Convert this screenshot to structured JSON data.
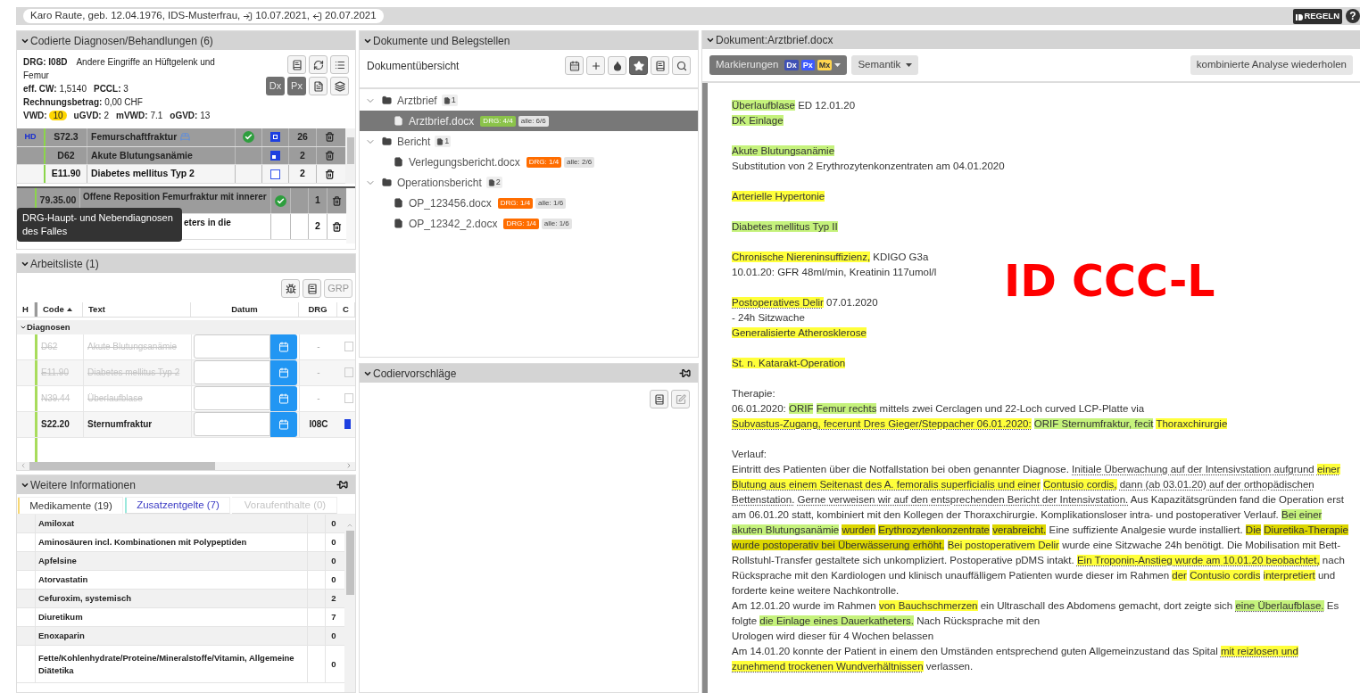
{
  "patient": {
    "info": "Karo Raute, geb. 12.04.1976, IDS-Musterfrau,",
    "admission": "10.07.2021,",
    "discharge": "20.07.2021"
  },
  "rules_button": "REGELN",
  "help_button": "?",
  "coded_panel": {
    "title": "Codierte Diagnosen/Behandlungen (6)",
    "drg": {
      "code": "DRG: I08D",
      "description": "Andere Eingriffe an Hüftgelenk und Femur"
    },
    "drg_rows": [
      [
        {
          "label": "eff. CW:",
          "value": "1,5140",
          "highlight": false
        },
        {
          "label": "PCCL:",
          "value": "3",
          "highlight": false
        }
      ],
      [
        {
          "label": "Rechnungsbetrag:",
          "value": "0,00 CHF",
          "highlight": false
        }
      ],
      [
        {
          "label": "VWD:",
          "value": "10",
          "highlight": true
        },
        {
          "label": "uGVD:",
          "value": "2",
          "highlight": false
        },
        {
          "label": "mVWD:",
          "value": "7.1",
          "highlight": false
        },
        {
          "label": "oGVD:",
          "value": "13",
          "highlight": false
        }
      ]
    ],
    "view_buttons": [
      {
        "label": "Dx",
        "selected": true
      },
      {
        "label": "Px",
        "selected": true
      }
    ],
    "diagnoses": [
      {
        "type": "HD",
        "code": "S72.3",
        "text": "Femurschaftfraktur",
        "bed_icon": true,
        "confirmed": true,
        "kind": "full",
        "count": "26",
        "selected": true
      },
      {
        "code": "D62",
        "text": "Akute Blutungsanämie",
        "bed_icon": false,
        "confirmed": false,
        "kind": "partial",
        "count": "2",
        "selected": true
      },
      {
        "code": "E11.90",
        "text": "Diabetes mellitus Typ 2",
        "bed_icon": false,
        "confirmed": false,
        "kind": "empty",
        "count": "2",
        "selected": false
      }
    ],
    "procedures": [
      {
        "code": "79.35.00",
        "text": "Offene Reposition Femurfraktur mit innerer",
        "confirmed": true,
        "count": "1",
        "selected": true
      },
      {
        "text": "eters in die",
        "confirmed": false,
        "count": "2",
        "selected": false
      }
    ],
    "tooltip": "DRG-Haupt- und Nebendiagnosen des Falles"
  },
  "worklist": {
    "title": "Arbeitsliste (1)",
    "grp_button": "GRP",
    "columns": [
      {
        "label": "H"
      },
      {
        "label": "Code",
        "sorted": true
      },
      {
        "label": "Text"
      },
      {
        "label": "Datum"
      },
      {
        "label": "DRG"
      },
      {
        "label": "C"
      }
    ],
    "group": {
      "label": "Diagnosen",
      "expanded": true
    },
    "rows": [
      {
        "code": "D62",
        "text": "Akute Blutungsanämie",
        "drg": "-",
        "deleted": true
      },
      {
        "code": "E11.90",
        "text": "Diabetes mellitus Typ 2",
        "drg": "-",
        "deleted": true
      },
      {
        "code": "N39.44",
        "text": "Überlaufblase",
        "drg": "-",
        "deleted": true
      },
      {
        "code": "S22.20",
        "text": "Sternumfraktur",
        "drg": "I08C",
        "deleted": false
      }
    ]
  },
  "info_panel": {
    "title": "Weitere Informationen",
    "pinned": true,
    "tabs": [
      {
        "label": "Medikamente (19)",
        "selected": true,
        "disabled": false,
        "color": "#f7d774"
      },
      {
        "label": "Zusatzentgelte (7)",
        "selected": false,
        "disabled": false,
        "color": "#9be8dc"
      },
      {
        "label": "Voraufenthalte (0)",
        "selected": false,
        "disabled": true
      }
    ],
    "rows": [
      {
        "name": "Amiloxat",
        "count": "0"
      },
      {
        "name": "Aminosäuren incl. Kombinationen mit Polypeptiden",
        "count": "0"
      },
      {
        "name": "Apfelsine",
        "count": "0"
      },
      {
        "name": "Atorvastatin",
        "count": "0"
      },
      {
        "name": "Cefuroxim, systemisch",
        "count": "2"
      },
      {
        "name": "Diuretikum",
        "count": "7"
      },
      {
        "name": "Enoxaparin",
        "count": "0"
      },
      {
        "name": "Fette/Kohlenhydrate/Proteine/Mineralstoffe/Vitamin, Allgemeine Diätetika",
        "count": "0"
      }
    ]
  },
  "documents_panel": {
    "title": "Dokumente und Belegstellen",
    "subtitle": "Dokumentübersicht",
    "toolbar": [
      {
        "selected": false
      },
      {
        "selected": false
      },
      {
        "selected": false
      },
      {
        "selected": true
      },
      {
        "selected": false
      },
      {
        "selected": false
      }
    ],
    "tree": [
      {
        "label": "Arztbrief",
        "count": "1",
        "expanded": true,
        "children": [
          {
            "label": "Arztbrief.docx",
            "selected": true,
            "drg": "DRG: 4/4",
            "color": "#8bc34a",
            "all": "alle: 6/6"
          }
        ]
      },
      {
        "label": "Bericht",
        "count": "1",
        "expanded": true,
        "children": [
          {
            "label": "Verlegungsbericht.docx",
            "selected": false,
            "drg": "DRG: 1/4",
            "color": "#ff6d00",
            "all": "alle: 2/6"
          }
        ]
      },
      {
        "label": "Operationsbericht",
        "count": "2",
        "expanded": true,
        "children": [
          {
            "label": "OP_123456.docx",
            "selected": false,
            "drg": "DRG: 1/4",
            "color": "#ff6d00",
            "all": "alle: 1/6"
          },
          {
            "label": "OP_12342_2.docx",
            "selected": false,
            "drg": "DRG: 1/4",
            "color": "#ff6d00",
            "all": "alle: 1/6"
          }
        ]
      }
    ]
  },
  "suggestions_panel": {
    "title": "Codiervorschläge",
    "pinned": true
  },
  "document_panel": {
    "title": "Dokument:Arztbrief.docx",
    "markings_button": {
      "label": "Markierungen",
      "badges": [
        {
          "text": "Dx",
          "color": "#3f51b5"
        },
        {
          "text": "Px",
          "color": "#3d5afe"
        },
        {
          "text": "Mx",
          "color": "#ffd54f"
        }
      ]
    },
    "semantics_button": "Semantik",
    "reanalyze_button": "kombinierte Analyse wiederholen",
    "overlay_label": "ID CCC-L",
    "sections": [
      [
        [
          {
            "text": "Überlaufblase",
            "color": "#c5f27c"
          },
          {
            "text": "ED 12.01.20"
          }
        ],
        [
          {
            "text": "DK Einlage",
            "color": "#c5f27c"
          }
        ]
      ],
      [
        [
          {
            "text": "Akute Blutungsanämie",
            "color": "#c5f27c"
          }
        ],
        [
          {
            "text": "Substitution von 2 Erythrozytenkonzentraten am 04.01.2020"
          }
        ]
      ],
      [
        [
          {
            "text": "Arterielle Hypertonie",
            "color": "#ffff3a"
          }
        ]
      ],
      [
        [
          {
            "text": "Diabetes mellitus Typ II",
            "color": "#c5f27c"
          }
        ]
      ],
      [
        [
          {
            "text": "Chronische Niereninsuffizienz,",
            "color": "#ffff3a"
          },
          {
            "text": "KDIGO G3a"
          }
        ],
        [
          {
            "text": "10.01.20: GFR 48ml/min, Kreatinin 117umol/l"
          }
        ]
      ],
      [
        [
          {
            "text": "Postoperatives Delir",
            "color": "#ffff3a",
            "dotted": true
          },
          {
            "text": "07.01.2020"
          }
        ],
        [
          {
            "text": "- 24h Sitzwache"
          }
        ],
        [
          {
            "text": "Generalisierte Atherosklerose",
            "color": "#ffff3a"
          }
        ]
      ],
      [
        [
          {
            "text": "St. n. Katarakt-Operation",
            "color": "#ffff3a"
          }
        ]
      ],
      [
        [
          {
            "text": "Therapie:"
          }
        ],
        [
          {
            "text": "06.01.2020:"
          },
          {
            "text": "ORIF",
            "color": "#c5f27c"
          },
          {
            "text": "Femur rechts",
            "color": "#c5f27c"
          },
          {
            "text": "mittels zwei Cerclagen und 22-Loch curved LCP-Platte via"
          }
        ],
        [
          {
            "text": "Subvastus-Zugang, fecerunt Dres Gieger/Steppacher 06.01.2020:",
            "color": "#ffff3a",
            "dotted": true
          },
          {
            "text": "ORIF Sternumfraktur, fecit",
            "color": "#c5f27c"
          },
          {
            "text": "Thoraxchirurgie",
            "color": "#ffff3a"
          }
        ]
      ],
      [
        [
          {
            "text": "Verlauf:"
          }
        ],
        [
          {
            "text": "Eintritt des Patienten über die Notfallstation bei oben genannter Diagnose."
          },
          {
            "text": "Initiale Überwachung auf der Intensivstation aufgrund",
            "dotted": true
          },
          {
            "text": "einer Blutung aus einem Seitenast des A. femoralis superficialis und einer",
            "color": "#ffff3a",
            "dotted": true
          },
          {
            "text": "Contusio cordis,",
            "color": "#ffff3a",
            "dotted": true
          },
          {
            "text": "dann (ab 03.01.20) auf der orthopädischen Bettenstation.",
            "dotted": true
          },
          {
            "text": "Gerne verweisen wir auf den entsprechenden Bericht der Intensivstation.",
            "dotted": true
          },
          {
            "text": "Aus Kapazitätsgründen fand die Operation erst am 06.01.20 statt, kombiniert mit den Kollegen der Thoraxchirurgie. Komplikationsloser intra- und postoperativer Verlauf."
          },
          {
            "text": "Bei einer akuten Blutungsanämie",
            "color": "#c5f27c"
          },
          {
            "text": "wurden",
            "color": "#dcd600"
          },
          {
            "text": "Erythrozytenkonzentrate",
            "color": "#dcd600"
          },
          {
            "text": "verabreicht.",
            "color": "#dcd600"
          },
          {
            "text": "Eine suffiziente Analgesie wurde installiert."
          },
          {
            "text": "Die",
            "color": "#dcd600"
          },
          {
            "text": "Diuretika-Therapie",
            "color": "#dcd600"
          },
          {
            "text": "wurde postoperativ bei Überwässerung erhöht.",
            "color": "#dcd600"
          },
          {
            "text": "Bei postoperativem Delir",
            "color": "#ffff3a"
          },
          {
            "text": "wurde eine Sitzwache 24h benötigt. Die Mobilisation mit Bett-Rollstuhl-Transfer gestaltete sich unkompliziert. Postoperative pDMS intakt."
          },
          {
            "text": "Ein Troponin-Anstieg wurde am 10.01.20 beobachtet,",
            "color": "#ffff3a",
            "dotted": true
          },
          {
            "text": "nach Rücksprache mit den Kardiologen und klinisch unauffälligem Patienten wurde dieser im Rahmen"
          },
          {
            "text": "der",
            "color": "#ffff3a"
          },
          {
            "text": "Contusio cordis",
            "color": "#ffff3a"
          },
          {
            "text": "interpretiert",
            "color": "#ffff3a"
          },
          {
            "text": "und forderte keine weitere Nachkontrolle."
          }
        ],
        [
          {
            "text": "Am 12.01.20 wurde im Rahmen"
          },
          {
            "text": "von Bauchschmerzen",
            "color": "#ffff3a"
          },
          {
            "text": "ein Ultraschall des Abdomens gemacht, dort zeigte sich"
          },
          {
            "text": "eine Überlaufblase.",
            "color": "#c5f27c",
            "dotted": true
          },
          {
            "text": "Es folgte"
          },
          {
            "text": "die Einlage eines Dauerkatheters.",
            "color": "#c5f27c"
          },
          {
            "text": "Nach Rücksprache mit den"
          }
        ],
        [
          {
            "text": "Urologen wird dieser für 4 Wochen belassen"
          }
        ],
        [
          {
            "text": "Am 14.01.20 konnte der Patient in einem den Umständen entsprechend guten Allgemeinzustand das Spital"
          },
          {
            "text": "mit reizlosen und zunehmend trockenen Wundverhältnissen",
            "color": "#ffff3a",
            "dotted": true
          },
          {
            "text": "verlassen."
          }
        ]
      ]
    ]
  }
}
